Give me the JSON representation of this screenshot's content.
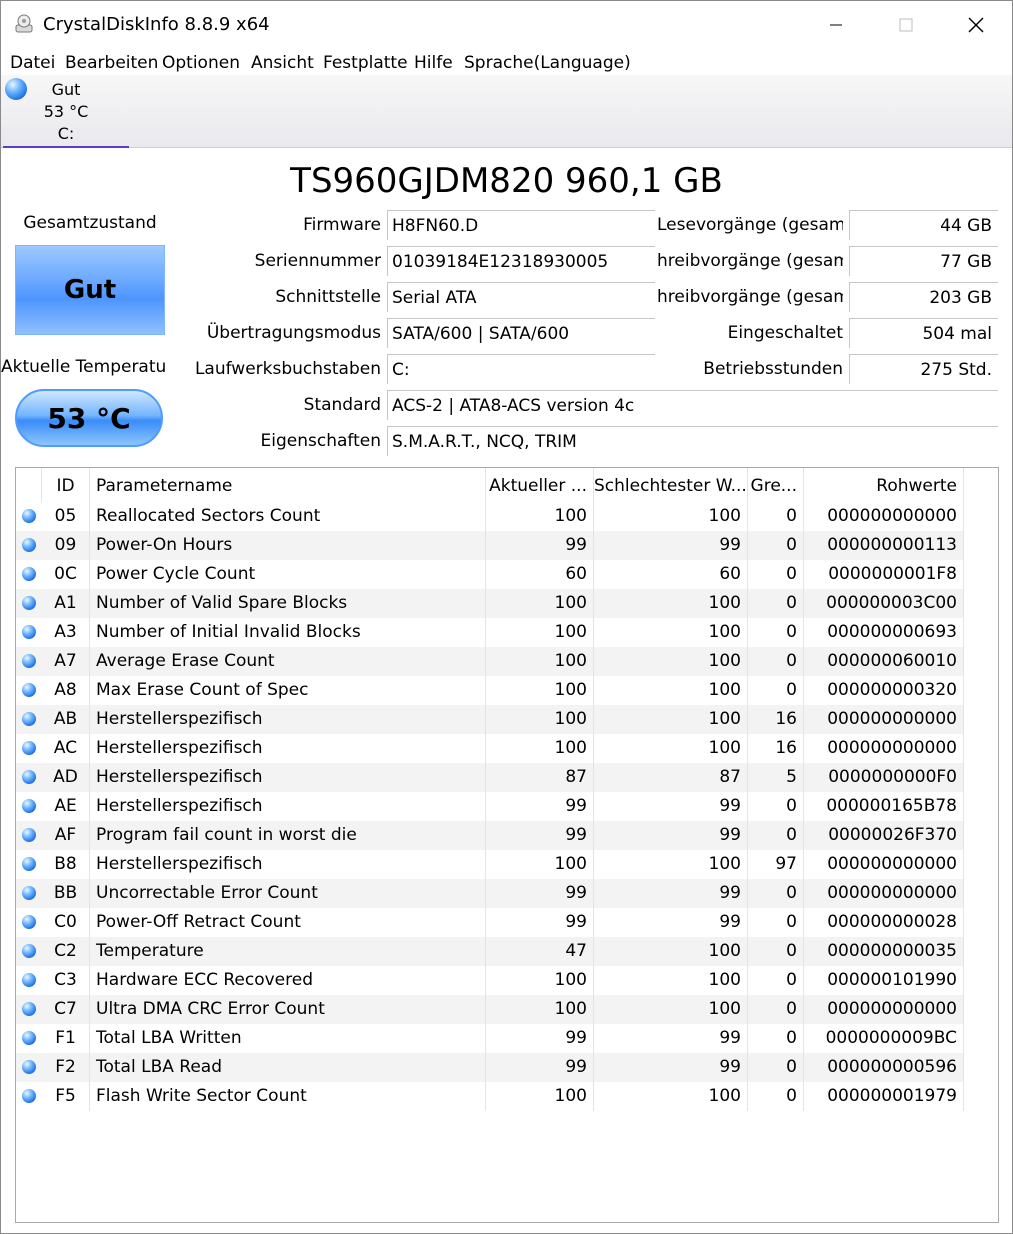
{
  "window": {
    "title": "CrystalDiskInfo 8.8.9 x64"
  },
  "menu": [
    "Datei",
    "Bearbeiten",
    "Optionen",
    "Ansicht",
    "Festplatte",
    "Hilfe",
    "Sprache(Language)"
  ],
  "disk_tab": {
    "status": "Gut",
    "temperature": "53 °C",
    "drive": "C:"
  },
  "model": "TS960GJDM820 960,1 GB",
  "health": {
    "label": "Gesamtzustand",
    "value": "Gut"
  },
  "temperature": {
    "label": "Aktuelle Temperatu",
    "value": "53 °C"
  },
  "info": {
    "firmware_label": "Firmware",
    "firmware": "H8FN60.D",
    "serial_label": "Seriennummer",
    "serial": "01039184E12318930005",
    "interface_label": "Schnittstelle",
    "interface": "Serial ATA",
    "transfer_label": "Übertragungsmodus",
    "transfer": "SATA/600 | SATA/600",
    "drive_letter_label": "Laufwerksbuchstaben",
    "drive_letter": "C:",
    "standard_label": "Standard",
    "standard": "ACS-2 | ATA8-ACS version 4c",
    "features_label": "Eigenschaften",
    "features": "S.M.A.R.T., NCQ, TRIM"
  },
  "stats": {
    "reads_label": "Lesevorgänge (gesamt)",
    "reads": "44 GB",
    "host_writes_label": "hreibvorgänge (gesamt)",
    "host_writes": "77 GB",
    "nand_writes_label": "hreibvorgänge (gesamt)",
    "nand_writes": "203 GB",
    "power_on_count_label": "Eingeschaltet",
    "power_on_count": "504 mal",
    "power_on_hours_label": "Betriebsstunden",
    "power_on_hours": "275 Std."
  },
  "table": {
    "headers": [
      "ID",
      "Parametername",
      "Aktueller ...",
      "Schlechtester W...",
      "Gre...",
      "Rohwerte"
    ],
    "rows": [
      [
        "05",
        "Reallocated Sectors Count",
        "100",
        "100",
        "0",
        "000000000000"
      ],
      [
        "09",
        "Power-On Hours",
        "99",
        "99",
        "0",
        "000000000113"
      ],
      [
        "0C",
        "Power Cycle Count",
        "60",
        "60",
        "0",
        "0000000001F8"
      ],
      [
        "A1",
        "Number of Valid Spare Blocks",
        "100",
        "100",
        "0",
        "000000003C00"
      ],
      [
        "A3",
        "Number of Initial Invalid Blocks",
        "100",
        "100",
        "0",
        "000000000693"
      ],
      [
        "A7",
        "Average Erase Count",
        "100",
        "100",
        "0",
        "000000060010"
      ],
      [
        "A8",
        "Max Erase Count of Spec",
        "100",
        "100",
        "0",
        "000000000320"
      ],
      [
        "AB",
        "Herstellerspezifisch",
        "100",
        "100",
        "16",
        "000000000000"
      ],
      [
        "AC",
        "Herstellerspezifisch",
        "100",
        "100",
        "16",
        "000000000000"
      ],
      [
        "AD",
        "Herstellerspezifisch",
        "87",
        "87",
        "5",
        "0000000000F0"
      ],
      [
        "AE",
        "Herstellerspezifisch",
        "99",
        "99",
        "0",
        "000000165B78"
      ],
      [
        "AF",
        "Program fail count in worst die",
        "99",
        "99",
        "0",
        "00000026F370"
      ],
      [
        "B8",
        "Herstellerspezifisch",
        "100",
        "100",
        "97",
        "000000000000"
      ],
      [
        "BB",
        "Uncorrectable Error Count",
        "99",
        "99",
        "0",
        "000000000000"
      ],
      [
        "C0",
        "Power-Off Retract Count",
        "99",
        "99",
        "0",
        "000000000028"
      ],
      [
        "C2",
        "Temperature",
        "47",
        "100",
        "0",
        "000000000035"
      ],
      [
        "C3",
        "Hardware ECC Recovered",
        "100",
        "100",
        "0",
        "000000101990"
      ],
      [
        "C7",
        "Ultra DMA CRC Error Count",
        "100",
        "100",
        "0",
        "000000000000"
      ],
      [
        "F1",
        "Total LBA Written",
        "99",
        "99",
        "0",
        "0000000009BC"
      ],
      [
        "F2",
        "Total LBA Read",
        "99",
        "99",
        "0",
        "000000000596"
      ],
      [
        "F5",
        "Flash Write Sector Count",
        "100",
        "100",
        "0",
        "000000001979"
      ]
    ]
  },
  "colors": {
    "good": "#4d95ff",
    "tab_underline": "#5a3cc6"
  }
}
